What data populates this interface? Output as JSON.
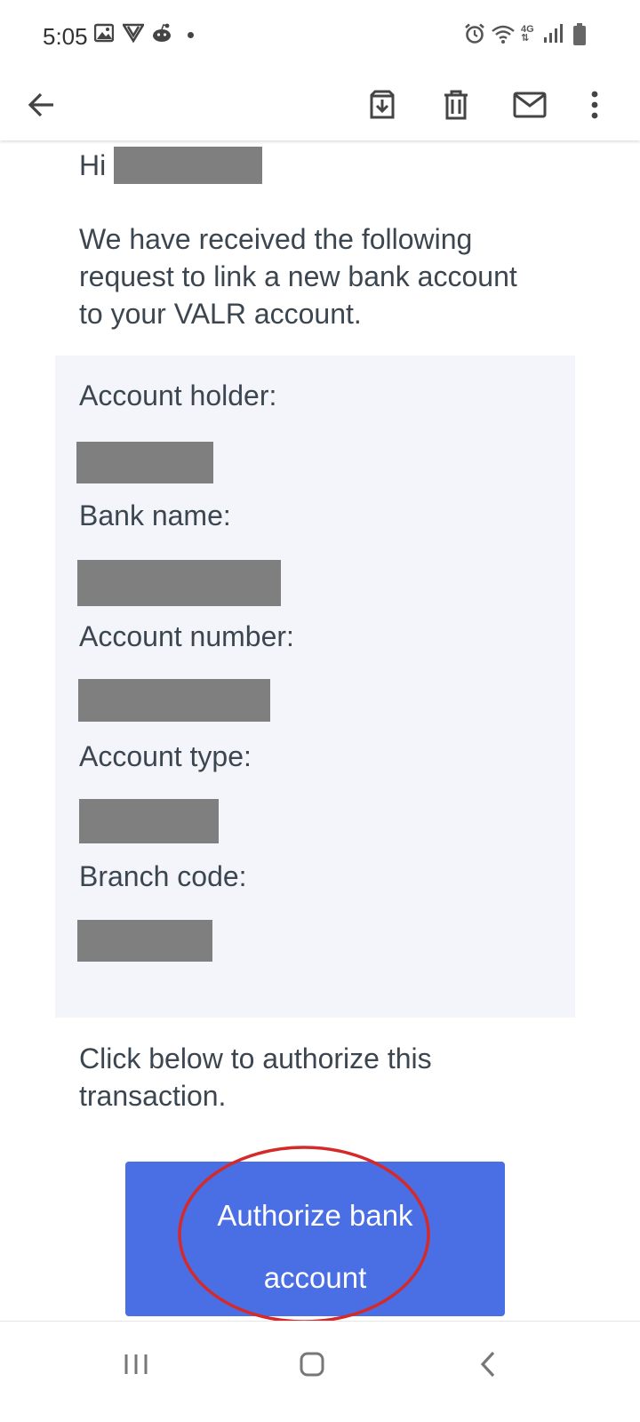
{
  "status_bar": {
    "time": "5:05",
    "network": "4G",
    "left_icons": [
      "gallery-icon",
      "vpn-icon",
      "reddit-icon",
      "notification-dot"
    ],
    "right_icons": [
      "alarm-icon",
      "wifi-icon",
      "4g-icon",
      "signal-icon",
      "battery-icon"
    ]
  },
  "toolbar": {
    "back": "back-arrow-icon",
    "actions": [
      "archive-icon",
      "delete-icon",
      "mark-unread-icon",
      "more-options-icon"
    ]
  },
  "email": {
    "greeting": "Hi",
    "intro": "We have received the following request to link a new bank account to your VALR account.",
    "details": {
      "account_holder_label": "Account holder:",
      "bank_name_label": "Bank name:",
      "account_number_label": "Account number:",
      "account_type_label": "Account type:",
      "branch_code_label": "Branch code:"
    },
    "outro": "Click below to authorize this transaction.",
    "cta_label": "Authorize bank account",
    "colors": {
      "text": "#3c4650",
      "details_bg": "#f3f5fa",
      "redaction": "#7f7f7f",
      "cta_bg": "#4a6ee3",
      "annotation_ellipse": "#d42a2a"
    }
  },
  "nav_bar": {
    "buttons": [
      "recents-icon",
      "home-icon",
      "nav-back-icon"
    ]
  }
}
